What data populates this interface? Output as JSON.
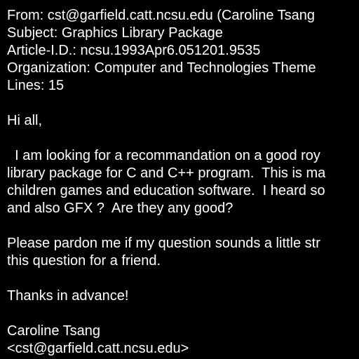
{
  "colors": {
    "background": "#000000",
    "text": "#ffffff"
  },
  "header": {
    "from": "From: cst@garfield.catt.ncsu.edu (Caroline Tsang",
    "subject": "Subject: Graphics Library Package",
    "article_id": "Article-I.D.: ncsu.1993Apr6.051201.9535",
    "organization": "Organization: Computer and Technologies Theme",
    "lines": "Lines: 15"
  },
  "body": {
    "greeting": "Hi all,",
    "paragraph1": [
      "  I am looking for a recommandation on a good roy",
      "library package for C and C++ program.  This is ma",
      "children games and education software.  I heard so",
      "and also GFX ?  Are they any good?"
    ],
    "paragraph2": [
      "Please pardon me if my question sounds a little str",
      "this question for a friend."
    ],
    "thanks": "Thanks in advance!",
    "signature": [
      "Caroline Tsang",
      "<cst@garfield.catt.ncsu.edu>"
    ]
  }
}
